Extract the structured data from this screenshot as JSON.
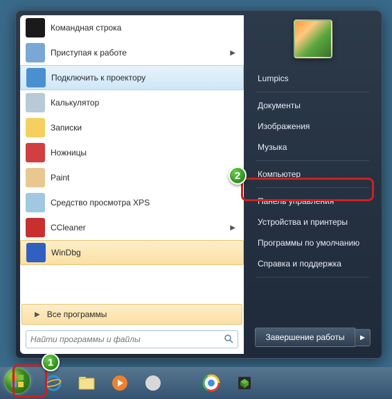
{
  "left_panel": {
    "programs": [
      {
        "label": "Командная строка",
        "icon": "cmd",
        "highlighted": false,
        "has_submenu": false
      },
      {
        "label": "Приступая к работе",
        "icon": "getting-started",
        "highlighted": false,
        "has_submenu": true
      },
      {
        "label": "Подключить к проектору",
        "icon": "projector",
        "highlighted": true,
        "has_submenu": false
      },
      {
        "label": "Калькулятор",
        "icon": "calculator",
        "highlighted": false,
        "has_submenu": false
      },
      {
        "label": "Записки",
        "icon": "sticky-notes",
        "highlighted": false,
        "has_submenu": false
      },
      {
        "label": "Ножницы",
        "icon": "snipping",
        "highlighted": false,
        "has_submenu": false
      },
      {
        "label": "Paint",
        "icon": "paint",
        "highlighted": false,
        "has_submenu": false
      },
      {
        "label": "Средство просмотра XPS",
        "icon": "xps",
        "highlighted": false,
        "has_submenu": false
      },
      {
        "label": "CCleaner",
        "icon": "ccleaner",
        "highlighted": false,
        "has_submenu": true
      },
      {
        "label": "WinDbg",
        "icon": "windbg",
        "highlighted": false,
        "has_submenu": false,
        "selected": true
      }
    ],
    "all_programs": "Все программы",
    "search_placeholder": "Найти программы и файлы"
  },
  "right_panel": {
    "items": [
      "Lumpics",
      "Документы",
      "Изображения",
      "Музыка",
      "Компьютер",
      "Панель управления",
      "Устройства и принтеры",
      "Программы по умолчанию",
      "Справка и поддержка"
    ],
    "separators_after": [
      0,
      3,
      4,
      8
    ],
    "shutdown": "Завершение работы"
  },
  "badges": {
    "1": "1",
    "2": "2"
  },
  "icon_colors": {
    "cmd": "#1a1a1a",
    "getting-started": "#7aa8d4",
    "projector": "#4a90d0",
    "calculator": "#b8cad8",
    "sticky-notes": "#f5d060",
    "snipping": "#d04040",
    "paint": "#e8c890",
    "xps": "#a0c8e0",
    "ccleaner": "#c83030",
    "windbg": "#3060c0"
  }
}
